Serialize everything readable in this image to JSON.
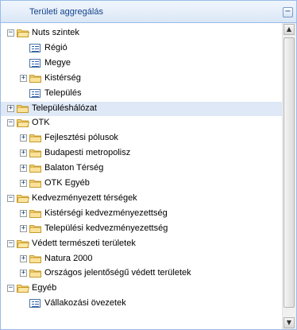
{
  "panel": {
    "title": "Területi aggregálás",
    "collapse_symbol": "−"
  },
  "tree": [
    {
      "label": "Nuts szintek",
      "type": "folder",
      "expanded": true,
      "level": 0
    },
    {
      "label": "Régió",
      "type": "leaf",
      "level": 1
    },
    {
      "label": "Megye",
      "type": "leaf",
      "level": 1
    },
    {
      "label": "Kistérség",
      "type": "folder",
      "expanded": false,
      "level": 1
    },
    {
      "label": "Település",
      "type": "leaf",
      "level": 1
    },
    {
      "label": "Településhálózat",
      "type": "folder",
      "expanded": false,
      "level": 0,
      "selected": true
    },
    {
      "label": "OTK",
      "type": "folder",
      "expanded": true,
      "level": 0
    },
    {
      "label": "Fejlesztési pólusok",
      "type": "folder",
      "expanded": false,
      "level": 1
    },
    {
      "label": "Budapesti metropolisz",
      "type": "folder",
      "expanded": false,
      "level": 1
    },
    {
      "label": "Balaton Térség",
      "type": "folder",
      "expanded": false,
      "level": 1
    },
    {
      "label": "OTK Egyéb",
      "type": "folder",
      "expanded": false,
      "level": 1
    },
    {
      "label": "Kedvezményezett térségek",
      "type": "folder",
      "expanded": true,
      "level": 0
    },
    {
      "label": "Kistérségi kedvezményezettség",
      "type": "folder",
      "expanded": false,
      "level": 1
    },
    {
      "label": "Települési kedvezményezettség",
      "type": "folder",
      "expanded": false,
      "level": 1
    },
    {
      "label": "Védett természeti területek",
      "type": "folder",
      "expanded": true,
      "level": 0
    },
    {
      "label": "Natura 2000",
      "type": "folder",
      "expanded": false,
      "level": 1
    },
    {
      "label": "Országos jelentőségű védett területek",
      "type": "folder",
      "expanded": false,
      "level": 1
    },
    {
      "label": "Egyéb",
      "type": "folder",
      "expanded": true,
      "level": 0
    },
    {
      "label": "Vállakozási övezetek",
      "type": "leaf",
      "level": 1
    }
  ],
  "scrollbar": {
    "up_symbol": "▲",
    "down_symbol": "▼"
  },
  "colors": {
    "header_text": "#15428b",
    "panel_border": "#99bbe8",
    "selected_row": "#dfe8f6",
    "folder": "#f5d67b"
  }
}
